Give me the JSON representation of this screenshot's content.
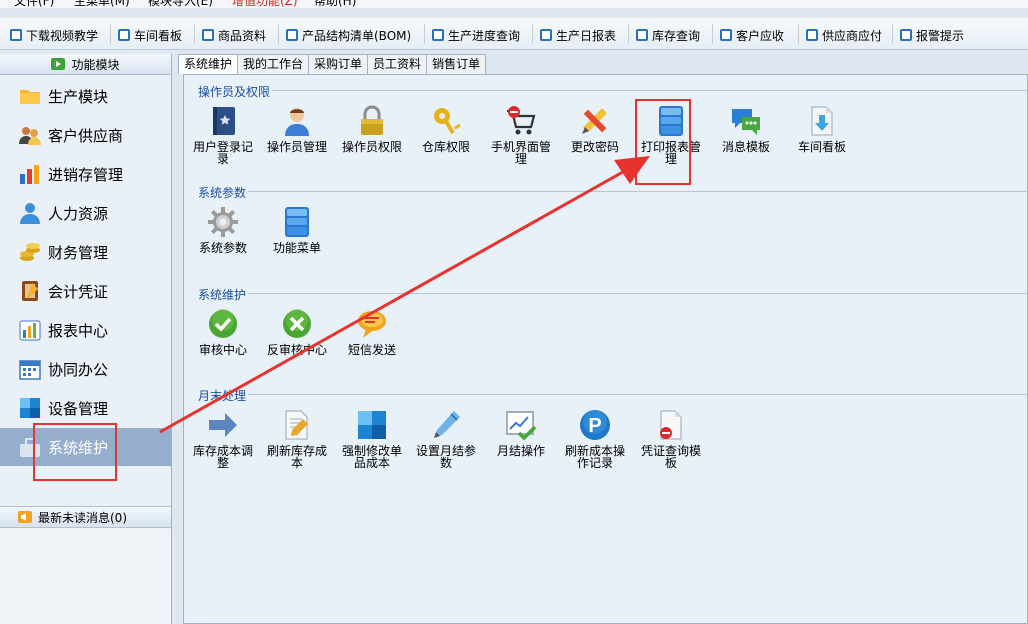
{
  "menubar": {
    "items": [
      "文件(F)",
      "主菜单(M)",
      "模块导入(E)",
      "增值功能(Z)",
      "帮助(H)"
    ]
  },
  "toolbar": {
    "items": [
      "下载视频教学",
      "车间看板",
      "商品资料",
      "产品结构清单(BOM)",
      "生产进度查询",
      "生产日报表",
      "库存查询",
      "客户应收",
      "供应商应付",
      "报警提示"
    ]
  },
  "leftpanel": {
    "header": "功能模块",
    "items": [
      "生产模块",
      "客户供应商",
      "进销存管理",
      "人力资源",
      "财务管理",
      "会计凭证",
      "报表中心",
      "协同办公",
      "设备管理",
      "系统维护"
    ],
    "message": "最新未读消息(0)"
  },
  "tabs": [
    "系统维护",
    "我的工作台",
    "采购订单",
    "员工资料",
    "销售订单"
  ],
  "sections": {
    "s1": {
      "title": "操作员及权限",
      "items": [
        "用户登录记录",
        "操作员管理",
        "操作员权限",
        "仓库权限",
        "手机界面管理",
        "更改密码",
        "打印报表管理",
        "消息模板",
        "车间看板"
      ]
    },
    "s2": {
      "title": "系统参数",
      "items": [
        "系统参数",
        "功能菜单"
      ]
    },
    "s3": {
      "title": "系统维护",
      "items": [
        "审核中心",
        "反审核中心",
        "短信发送"
      ]
    },
    "s4": {
      "title": "月末处理",
      "items": [
        "库存成本调整",
        "刷新库存成本",
        "强制修改单品成本",
        "设置月结参数",
        "月结操作",
        "刷新成本操作记录",
        "凭证查询模板"
      ]
    }
  },
  "colors": {
    "accent": "#1b4fa0",
    "highlight": "#e8322d",
    "active_bg": "#96aece"
  }
}
